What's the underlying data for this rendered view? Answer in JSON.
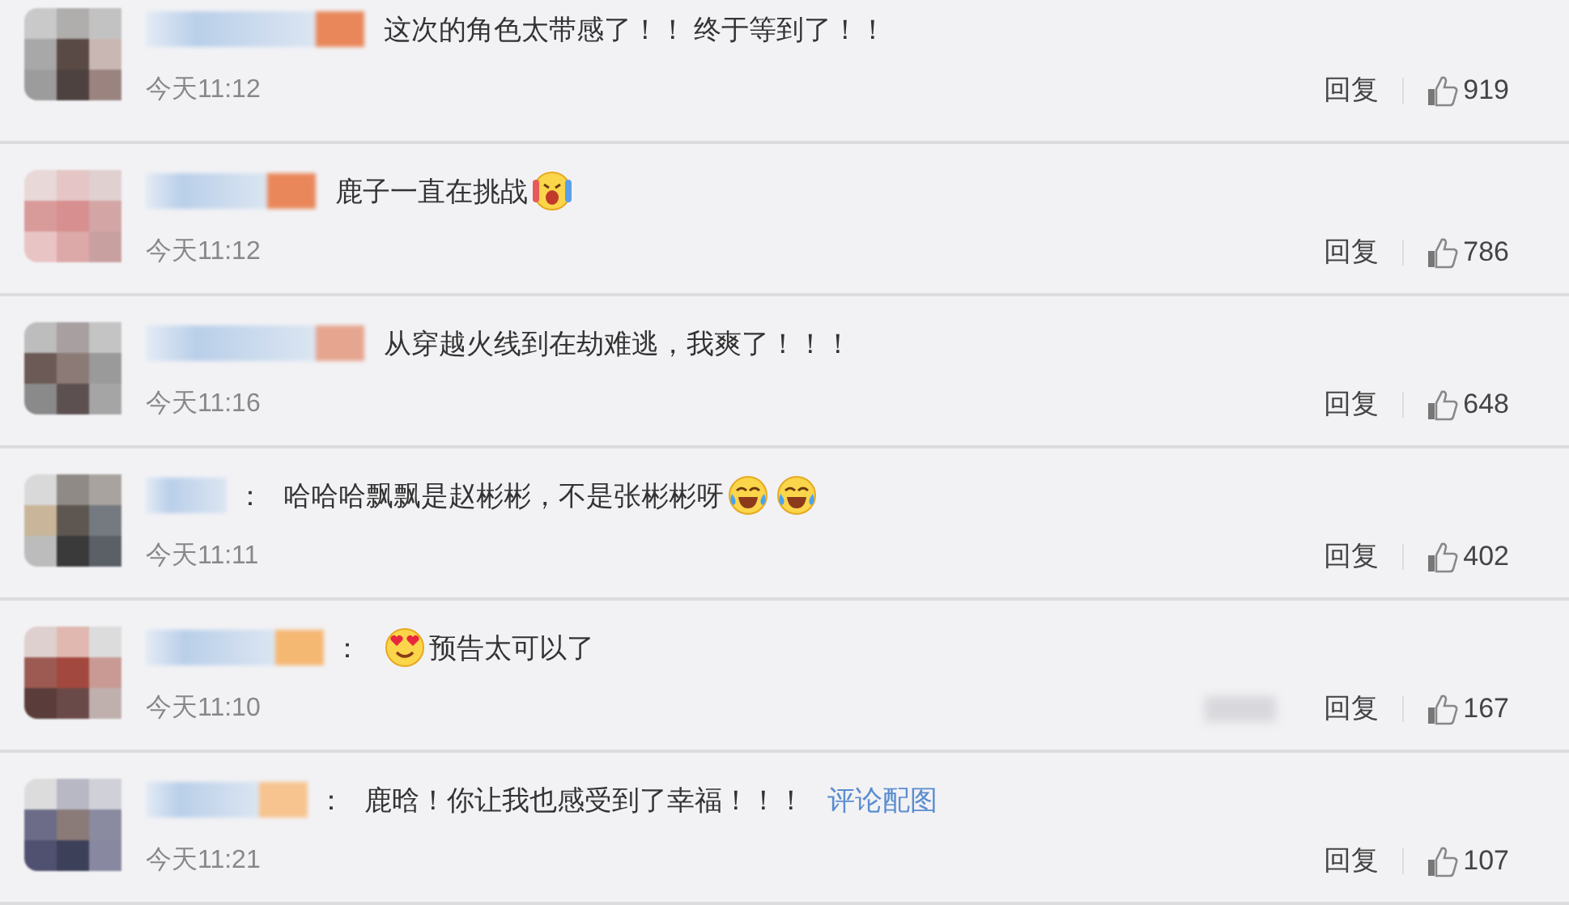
{
  "comments": [
    {
      "parts": [
        {
          "kind": "text",
          "text": "这次的角色太带感了！！ 终于等到了！！"
        }
      ],
      "time": "今天11:12",
      "reply": "回复",
      "likes": "919",
      "extra_blur": false
    },
    {
      "parts": [
        {
          "kind": "text",
          "text": "鹿子一直在挑战"
        },
        {
          "kind": "emoji_screaming"
        }
      ],
      "time": "今天11:12",
      "reply": "回复",
      "likes": "786",
      "extra_blur": false
    },
    {
      "parts": [
        {
          "kind": "text",
          "text": "从穿越火线到在劫难逃，我爽了！！！"
        }
      ],
      "time": "今天11:16",
      "reply": "回复",
      "likes": "648",
      "extra_blur": false
    },
    {
      "colon": "：",
      "parts": [
        {
          "kind": "text",
          "text": "哈哈哈飘飘是赵彬彬，不是张彬彬呀"
        },
        {
          "kind": "emoji_tears_of_joy"
        },
        {
          "kind": "emoji_tears_of_joy"
        }
      ],
      "time": "今天11:11",
      "reply": "回复",
      "likes": "402",
      "extra_blur": false
    },
    {
      "colon": "：",
      "parts": [
        {
          "kind": "emoji_heart_eyes"
        },
        {
          "kind": "text",
          "text": "预告太可以了"
        }
      ],
      "time": "今天11:10",
      "reply": "回复",
      "likes": "167",
      "extra_blur": true
    },
    {
      "colon": "：",
      "parts": [
        {
          "kind": "text",
          "text": "鹿晗！你让我也感受到了幸福！！！"
        },
        {
          "kind": "link",
          "text": "评论配图"
        }
      ],
      "time": "今天11:21",
      "reply": "回复",
      "likes": "107",
      "extra_blur": false
    }
  ]
}
